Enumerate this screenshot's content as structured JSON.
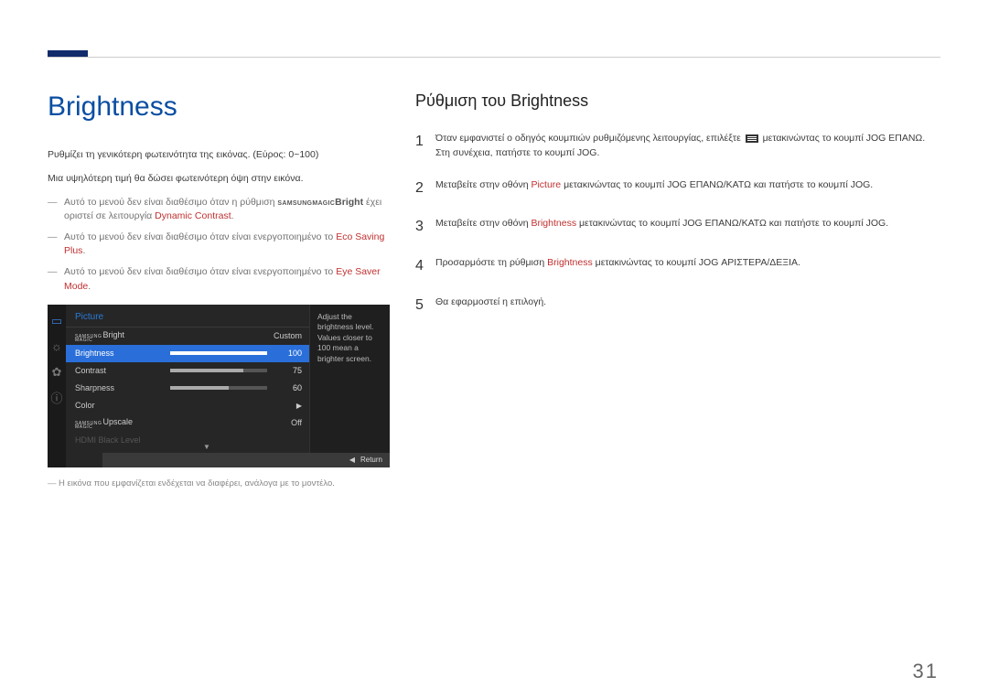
{
  "page_number": "31",
  "left": {
    "title": "Brightness",
    "desc1": "Ρυθμίζει τη γενικότερη φωτεινότητα της εικόνας. (Εύρος: 0~100)",
    "desc2": "Μια υψηλότερη τιμή θα δώσει φωτεινότερη όψη στην εικόνα.",
    "note1_pre": "Αυτό το μενού δεν είναι διαθέσιμο όταν η ρύθμιση ",
    "note1_magic_small": "SAMSUNG",
    "note1_magic2": "MAGIC",
    "note1_bright": "Bright",
    "note1_mid": " έχει οριστεί σε λειτουργία ",
    "note1_red": "Dynamic Contrast",
    "note2_pre": "Αυτό το μενού δεν είναι διαθέσιμο όταν είναι ενεργοποιημένο το ",
    "note2_red": "Eco Saving Plus",
    "note3_pre": "Αυτό το μενού δεν είναι διαθέσιμο όταν είναι ενεργοποιημένο το ",
    "note3_red": "Eye Saver Mode",
    "caption": "Η εικόνα που εμφανίζεται ενδέχεται να διαφέρει, ανάλογα με το μοντέλο."
  },
  "osd": {
    "title": "Picture",
    "magic_top": "SAMSUNG",
    "magic_bot": "MAGIC",
    "row_bright_suffix": "Bright",
    "row_bright_val": "Custom",
    "rows": [
      {
        "label": "Brightness",
        "val": "100",
        "fill": 100
      },
      {
        "label": "Contrast",
        "val": "75",
        "fill": 75
      },
      {
        "label": "Sharpness",
        "val": "60",
        "fill": 60
      }
    ],
    "row_color": "Color",
    "row_upscale_suffix": "Upscale",
    "row_upscale_val": "Off",
    "row_disabled": "HDMI Black Level",
    "desc": "Adjust the brightness level. Values closer to 100 mean a brighter screen.",
    "return": "Return"
  },
  "right": {
    "title": "Ρύθμιση του Brightness",
    "steps": {
      "s1_a": "Όταν εμφανιστεί ο οδηγός κουμπιών ρυθμιζόμενης λειτουργίας, επιλέξτε ",
      "s1_b": " μετακινώντας το κουμπί JOG ΕΠΑΝΩ. Στη συνέχεια, πατήστε το κουμπί JOG.",
      "s2_a": "Μεταβείτε στην οθόνη ",
      "s2_red": "Picture",
      "s2_b": " μετακινώντας το κουμπί JOG ΕΠΑΝΩ/ΚΑΤΩ και πατήστε το κουμπί JOG.",
      "s3_a": "Μεταβείτε στην οθόνη ",
      "s3_red": "Brightness",
      "s3_b": " μετακινώντας το κουμπί JOG ΕΠΑΝΩ/ΚΑΤΩ και πατήστε το κουμπί JOG.",
      "s4_a": "Προσαρμόστε τη ρύθμιση ",
      "s4_red": "Brightness",
      "s4_b": " μετακινώντας το κουμπί JOG ΑΡΙΣΤΕΡΑ/ΔΕΞΙΑ.",
      "s5": "Θα εφαρμοστεί η επιλογή."
    },
    "nums": {
      "n1": "1",
      "n2": "2",
      "n3": "3",
      "n4": "4",
      "n5": "5"
    }
  }
}
